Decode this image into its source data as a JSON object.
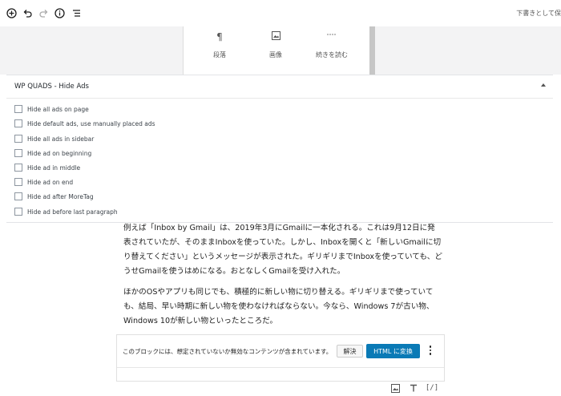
{
  "toolbar": {
    "add_icon": "plus-circle-icon",
    "undo_icon": "undo-icon",
    "redo_icon": "redo-icon",
    "info_icon": "info-icon",
    "outline_icon": "list-outline-icon",
    "saved_label": "下書きとして保"
  },
  "inserter": {
    "items": [
      {
        "icon": "paragraph-icon",
        "label": "段落"
      },
      {
        "icon": "image-icon",
        "label": "画像"
      },
      {
        "icon": "more-icon",
        "label": "続きを読む"
      }
    ]
  },
  "metabox": {
    "title": "WP QUADS - Hide Ads",
    "options": [
      "Hide all ads on page",
      "Hide default ads, use manually placed ads",
      "Hide all ads in sidebar",
      "Hide ad on beginning",
      "Hide ad in middle",
      "Hide ad on end",
      "Hide ad after MoreTag",
      "Hide ad before last paragraph"
    ]
  },
  "content": {
    "paragraph1": "例えば「Inbox by Gmail」は、2019年3月にGmailに一本化される。これは9月12日に発表されていたが、そのままInboxを使っていた。しかし、Inboxを開くと「新しいGmailに切り替えてください」というメッセージが表示された。ギリギリまでInboxを使っていても、どうせGmailを使うはめになる。おとなしくGmailを受け入れた。",
    "paragraph2": "ほかのOSやアプリも同じでも、積極的に新しい物に切り替える。ギリギリまで使っていても、結局、早い時期に新しい物を使わなければならない。今なら、Windows 7が古い物、Windows 10が新しい物といったところだ。"
  },
  "invalid_block": {
    "warning": "このブロックには、想定されていないか無効なコンテンツが含まれています。",
    "resolve_label": "解決",
    "convert_label": "HTML に変換"
  },
  "appender": {
    "icons": [
      "image-icon",
      "heading-icon",
      "shortcode-icon"
    ],
    "shortcode_text": "[/]"
  }
}
